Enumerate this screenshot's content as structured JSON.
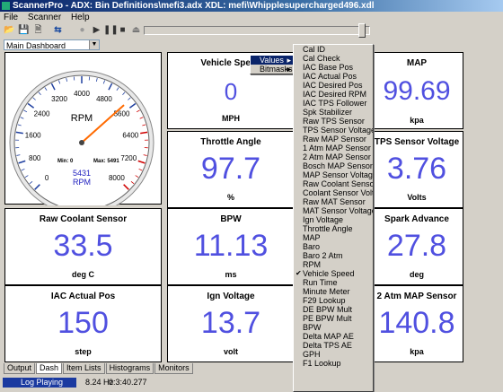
{
  "window": {
    "title": "ScannerPro - ADX: Bin Definitions\\mefi3.adx  XDL: mefi\\Whipplesupercharged496.xdl"
  },
  "menu": {
    "items": [
      "File",
      "Scanner",
      "Help"
    ]
  },
  "dashboard_select": {
    "value": "Main Dashboard"
  },
  "gauge": {
    "label": "RPM",
    "ticks": [
      "0",
      "800",
      "1600",
      "2400",
      "3200",
      "4000",
      "4800",
      "5600",
      "6400",
      "7200",
      "8000"
    ],
    "min_label": "Min: 0",
    "max_label": "Max: 5491",
    "digital_value": "5431",
    "digital_unit": "RPM",
    "needle_value": 5431,
    "max": 8000
  },
  "panels": [
    {
      "title": "Vehicle Speed",
      "value": "0",
      "unit": "MPH"
    },
    {
      "title": "MAP",
      "value": "99.69",
      "unit": "kpa"
    },
    {
      "title": "Throttle Angle",
      "value": "97.7",
      "unit": "%"
    },
    {
      "title": "TPS Sensor Voltage",
      "value": "3.76",
      "unit": "Volts"
    },
    {
      "title": "Raw Coolant Sensor",
      "value": "33.5",
      "unit": "deg C"
    },
    {
      "title": "BPW",
      "value": "11.13",
      "unit": "ms"
    },
    {
      "title": "Spark Advance",
      "value": "27.8",
      "unit": "deg"
    },
    {
      "title": "IAC Actual Pos",
      "value": "150",
      "unit": "step"
    },
    {
      "title": "Ign Voltage",
      "value": "13.7",
      "unit": "volt"
    },
    {
      "title": "2 Atm MAP Sensor",
      "value": "140.8",
      "unit": "kpa"
    }
  ],
  "context_menu": {
    "values": "Values",
    "bitmasks": "Bitmasks"
  },
  "values_menu": {
    "items": [
      "Cal ID",
      "Cal Check",
      "IAC Base Pos",
      "IAC Actual Pos",
      "IAC Desired Pos",
      "IAC Desired RPM",
      "IAC TPS Follower",
      "Spk Stabilizer",
      "Raw TPS Sensor",
      "TPS Sensor Voltage",
      "Raw MAP Sensor",
      "1 Atm MAP Sensor",
      "2 Atm MAP Sensor",
      "Bosch MAP Sensor",
      "MAP Sensor Voltage",
      "Raw Coolant Sensor",
      "Coolant Sensor Voltage",
      "Raw MAT Sensor",
      "MAT Sensor Voltage",
      "Ign Voltage",
      "Throttle Angle",
      "MAP",
      "Baro",
      "Baro 2 Atm",
      "RPM",
      "Vehicle Speed",
      "Run Time",
      "Minute Meter",
      "F29 Lookup",
      "DE BPW Mult",
      "PE BPW Mult",
      "BPW",
      "Delta MAP AE",
      "Delta TPS AE",
      "GPH",
      "F1 Lookup"
    ],
    "checked": "Vehicle Speed"
  },
  "tabs": [
    "Output",
    "Dash",
    "Item Lists",
    "Histograms",
    "Monitors"
  ],
  "active_tab": "Dash",
  "status": {
    "mode": "Log Playing",
    "rate": "8.24 Hz",
    "time": "0:3:40.277"
  },
  "colors": {
    "value_text": "#5050e0",
    "needle": "#ff6a00",
    "status_bg": "#1a3aa0",
    "menu_highlight": "#0a246a"
  },
  "toolbar_icons": [
    "open-icon",
    "save-icon",
    "save-as-icon",
    "connect-icon",
    "record-icon",
    "play-icon",
    "pause-icon",
    "stop-icon",
    "eject-icon"
  ]
}
